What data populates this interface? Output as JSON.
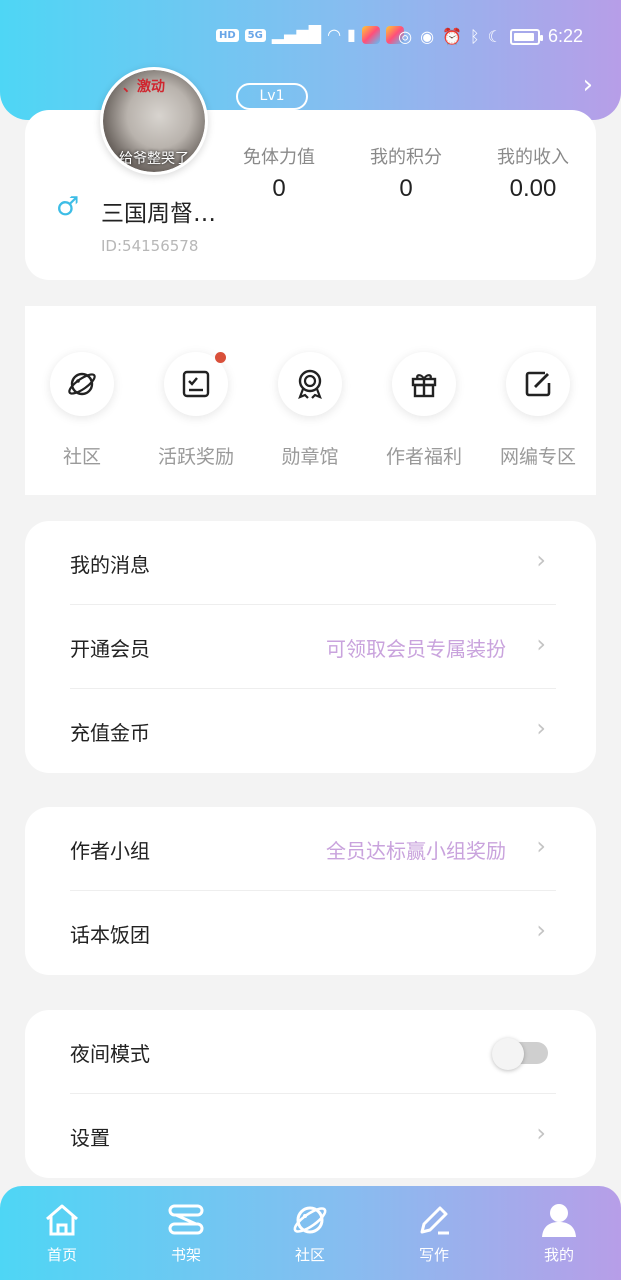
{
  "status_bar": {
    "hd": "HD",
    "network": "5G",
    "time": "6:22"
  },
  "header": {
    "level": "Lv1",
    "avatar_caption_top": "、激动",
    "avatar_caption_bottom": "给爷整哭了"
  },
  "profile": {
    "gender_symbol": "♂",
    "nickname": "三国周督…",
    "user_id": "ID:54156578",
    "stats": [
      {
        "label": "免体力值",
        "value": "0"
      },
      {
        "label": "我的积分",
        "value": "0"
      },
      {
        "label": "我的收入",
        "value": "0.00"
      }
    ]
  },
  "quick_actions": [
    {
      "label": "社区",
      "icon": "planet-icon",
      "badge": false
    },
    {
      "label": "活跃奖励",
      "icon": "checklist-icon",
      "badge": true
    },
    {
      "label": "勋章馆",
      "icon": "medal-icon",
      "badge": false
    },
    {
      "label": "作者福利",
      "icon": "gift-icon",
      "badge": false
    },
    {
      "label": "网编专区",
      "icon": "edit-icon",
      "badge": false
    }
  ],
  "menu_group_1": [
    {
      "title": "我的消息",
      "hint": ""
    },
    {
      "title": "开通会员",
      "hint": "可领取会员专属装扮"
    },
    {
      "title": "充值金币",
      "hint": ""
    }
  ],
  "menu_group_2": [
    {
      "title": "作者小组",
      "hint": "全员达标赢小组奖励"
    },
    {
      "title": "话本饭团",
      "hint": ""
    }
  ],
  "menu_group_3": {
    "night_mode": {
      "title": "夜间模式",
      "enabled": false
    },
    "settings": {
      "title": "设置"
    }
  },
  "tabbar": [
    {
      "label": "首页",
      "icon": "home-icon"
    },
    {
      "label": "书架",
      "icon": "bookshelf-icon"
    },
    {
      "label": "社区",
      "icon": "planet-icon"
    },
    {
      "label": "写作",
      "icon": "pen-icon"
    },
    {
      "label": "我的",
      "icon": "user-icon",
      "active": true
    }
  ],
  "colors": {
    "gradient_start": "#4ed6f5",
    "gradient_end": "#b79ee8",
    "hint_purple": "#c9a3dd",
    "badge_red": "#d9503a",
    "gender_blue": "#3dbde6"
  }
}
